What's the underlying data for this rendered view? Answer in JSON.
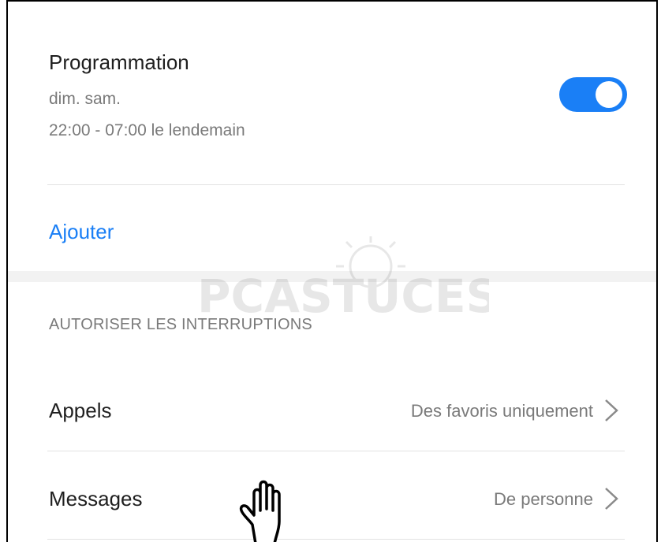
{
  "schedule": {
    "title": "Programmation",
    "days": "dim. sam.",
    "time_range": "22:00 - 07:00 le lendemain",
    "toggle_state": "on"
  },
  "add_label": "Ajouter",
  "watermark_text": "PCASTUCES",
  "interruptions": {
    "header": "AUTORISER LES INTERRUPTIONS",
    "rows": [
      {
        "label": "Appels",
        "value": "Des favoris uniquement"
      },
      {
        "label": "Messages",
        "value": "De personne"
      }
    ]
  },
  "icons": {
    "chevron": "chevron-right-icon",
    "hand": "hand-pointer-icon",
    "watermark": "pcastuces-logo"
  },
  "colors": {
    "accent": "#1a7ff6",
    "text_primary": "#1f1f1f",
    "text_secondary": "#7a7a7a",
    "divider": "#e3e3e3"
  }
}
